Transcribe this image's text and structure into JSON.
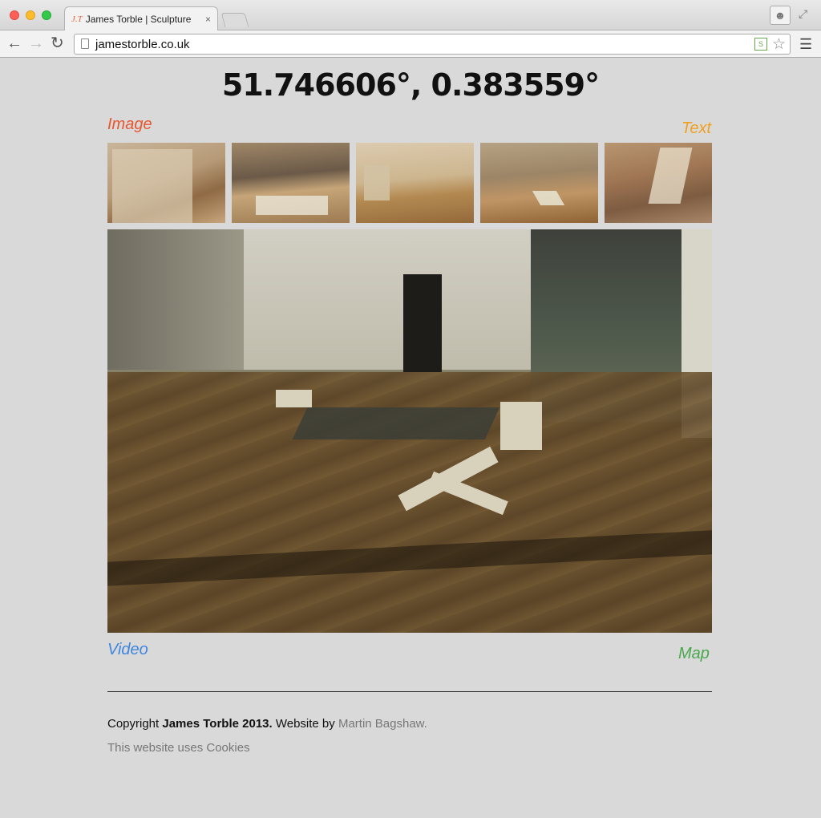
{
  "browser": {
    "tab_logo": "J.T",
    "tab_title": "James Torble | Sculpture",
    "tab_close": "×",
    "url": "jamestorble.co.uk"
  },
  "page": {
    "coordinates": "51.746606°, 0.383559°",
    "links": {
      "image": "Image",
      "text": "Text",
      "video": "Video",
      "map": "Map"
    },
    "colors": {
      "image": "#e8562f",
      "text": "#f0a020",
      "video": "#3f86e0",
      "map": "#4aa84f",
      "background": "#d9d9d9"
    }
  },
  "footer": {
    "copyright_prefix": "Copyright ",
    "copyright_owner": "James Torble 2013.",
    "website_by": " Website by ",
    "designer": "Martin Bagshaw.",
    "cookies": "This website uses Cookies"
  }
}
